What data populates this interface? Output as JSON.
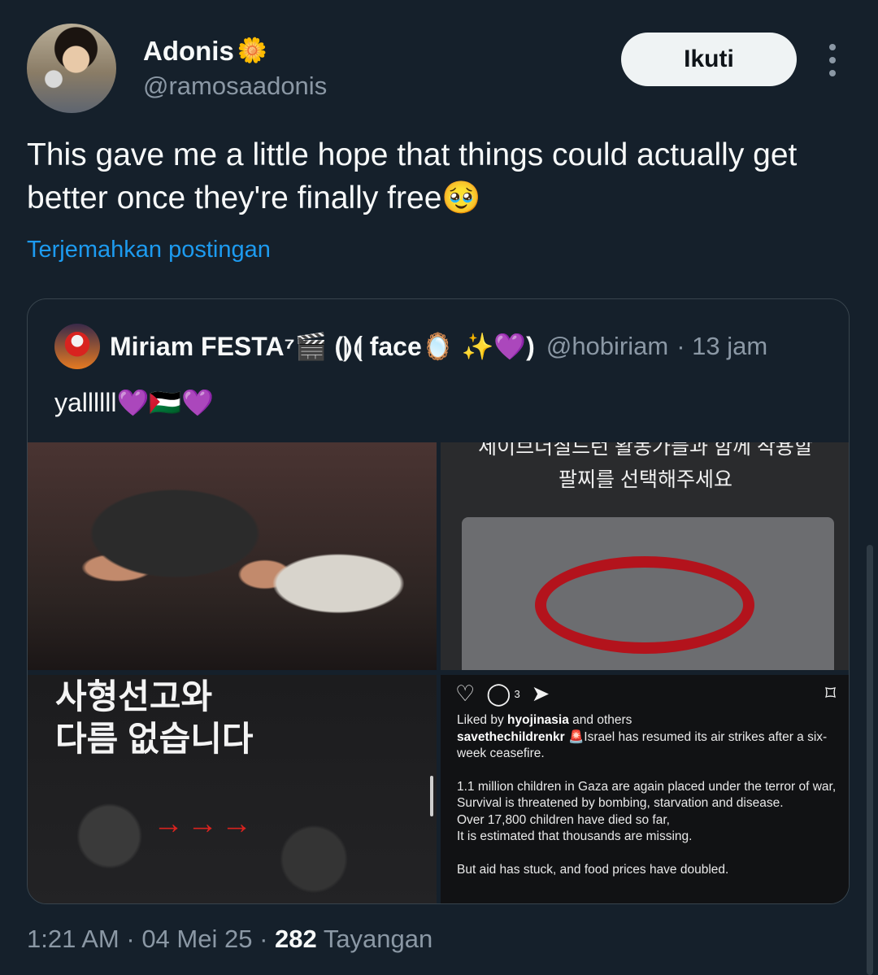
{
  "tweet": {
    "author_name": "Adonis",
    "author_badge": "🌼",
    "author_handle": "@ramosaadonis",
    "follow_label": "Ikuti",
    "text": "This gave me a little hope that things could actually get better once they're finally free🥹",
    "translate_label": "Terjemahkan postingan",
    "time": "1:21 AM",
    "date": "04 Mei 25",
    "views_count": "282",
    "views_label": "Tayangan"
  },
  "quote": {
    "author_name": "Miriam FESTA⁷🎬 (⟭⟬ face🪞 ✨💜)",
    "author_handle": "@hobiriam",
    "age": "· 13 jam",
    "text": "yallllll💜🇵🇸💜",
    "images": {
      "bracelet_line1": "세이브더칠드런 활동가들과 함께 착용할",
      "bracelet_line2": "팔찌를 선택해주세요",
      "rubble_line1": "사형선고와",
      "rubble_line2": "다름 없습니다",
      "rubble_arrows": "→→→",
      "insta_comment_count": "3",
      "insta_liked_prefix": "Liked by",
      "insta_liked_user": "hyojinasia",
      "insta_liked_suffix": "and others",
      "insta_poster": "savethechildrenkr",
      "insta_caption1": "🚨Israel has resumed its air strikes after a six-week ceasefire.",
      "insta_caption2": "1.1 million children in Gaza are again placed under the terror of war,",
      "insta_caption3": "Survival is threatened by bombing, starvation and disease.",
      "insta_caption4": "Over 17,800 children have died so far,",
      "insta_caption5": "It is estimated that thousands are missing.",
      "insta_caption6": "But aid has stuck, and food prices have doubled."
    }
  },
  "icons": [
    "flower-icon",
    "more-icon",
    "heart-icon",
    "comment-icon",
    "share-icon",
    "bookmark-icon"
  ]
}
